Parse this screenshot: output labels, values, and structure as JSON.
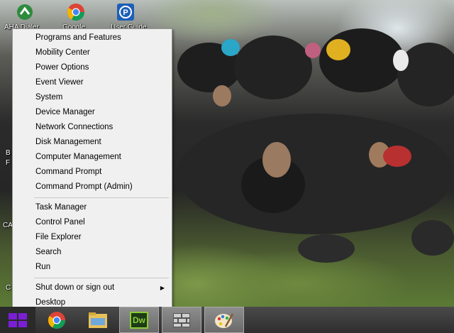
{
  "desktop": {
    "icons": [
      {
        "name": "aiu-dialer",
        "label": "AHA Dialer"
      },
      {
        "name": "google-chrome",
        "label": "Google"
      },
      {
        "name": "user-guide",
        "label": "User Guide"
      }
    ],
    "edge_letters": [
      "B",
      "F",
      "CA",
      "C"
    ]
  },
  "context_menu": {
    "group1": [
      "Programs and Features",
      "Mobility Center",
      "Power Options",
      "Event Viewer",
      "System",
      "Device Manager",
      "Network Connections",
      "Disk Management",
      "Computer Management",
      "Command Prompt",
      "Command Prompt (Admin)"
    ],
    "group2": [
      "Task Manager",
      "Control Panel",
      "File Explorer",
      "Search",
      "Run"
    ],
    "group3": [
      {
        "label": "Shut down or sign out",
        "submenu": true
      },
      {
        "label": "Desktop",
        "submenu": false
      }
    ]
  },
  "taskbar": {
    "apps": [
      {
        "name": "chrome",
        "label": ""
      },
      {
        "name": "file-explorer",
        "label": ""
      },
      {
        "name": "dreamweaver",
        "label": "Dw"
      },
      {
        "name": "brick-app",
        "label": ""
      },
      {
        "name": "paint",
        "label": ""
      }
    ]
  },
  "colors": {
    "start_accent": "#7a1fd6",
    "menu_bg": "#f0f0f0",
    "dw_green": "#8ccc35"
  }
}
